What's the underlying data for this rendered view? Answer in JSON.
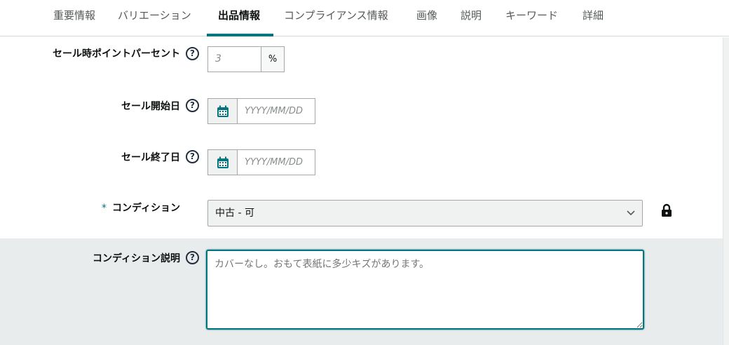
{
  "tabs": [
    {
      "label": "重要情報"
    },
    {
      "label": "バリエーション"
    },
    {
      "label": "出品情報",
      "active": true
    },
    {
      "label": "コンプライアンス情報"
    },
    {
      "label": "画像"
    },
    {
      "label": "説明"
    },
    {
      "label": "キーワード"
    },
    {
      "label": "詳細"
    }
  ],
  "fields": {
    "sale_points": {
      "label": "セール時ポイントパーセント",
      "placeholder": "3",
      "unit": "%"
    },
    "sale_start": {
      "label": "セール開始日",
      "placeholder": "YYYY/MM/DD"
    },
    "sale_end": {
      "label": "セール終了日",
      "placeholder": "YYYY/MM/DD"
    },
    "condition": {
      "required_mark": "*",
      "label": "コンディション",
      "value": "中古 - 可"
    },
    "condition_note": {
      "label": "コンディション説明",
      "value": "カバーなし。おもて表紙に多少キズがあります。"
    }
  },
  "help_glyph": "?",
  "icons": {
    "help": "help-circle-icon",
    "calendar": "calendar-icon",
    "chevron": "chevron-down-icon",
    "lock": "lock-icon"
  },
  "colors": {
    "accent": "#00747f",
    "text": "#0f1111",
    "muted": "#565959",
    "section_bg": "#e9ecec"
  }
}
